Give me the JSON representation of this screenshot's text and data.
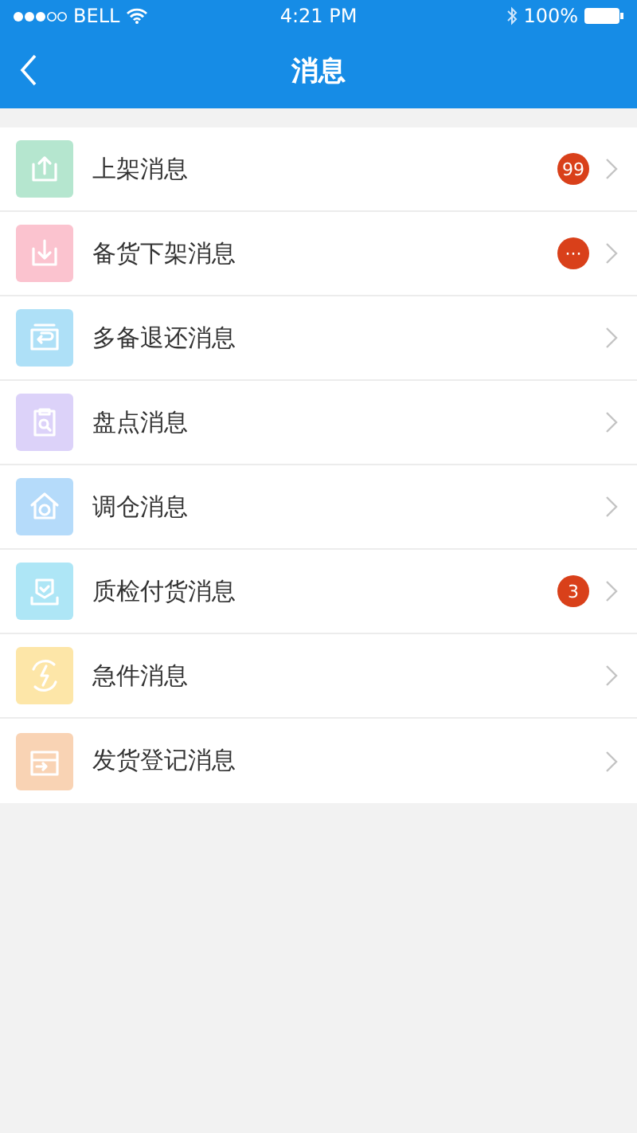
{
  "status_bar": {
    "carrier": "BELL",
    "time": "4:21 PM",
    "battery": "100%"
  },
  "nav": {
    "title": "消息"
  },
  "items": [
    {
      "label": "上架消息",
      "kind": "upload",
      "color": "#b5e6cf",
      "badge": "99"
    },
    {
      "label": "备货下架消息",
      "kind": "download",
      "color": "#fbc3cf",
      "badge": "···"
    },
    {
      "label": "多备退还消息",
      "kind": "return",
      "color": "#aee0f7"
    },
    {
      "label": "盘点消息",
      "kind": "inventory",
      "color": "#dcd2f9"
    },
    {
      "label": "调仓消息",
      "kind": "transfer",
      "color": "#b5dbfa"
    },
    {
      "label": "质检付货消息",
      "kind": "inspect",
      "color": "#aee6f6",
      "badge": "3"
    },
    {
      "label": "急件消息",
      "kind": "urgent",
      "color": "#fde6a8"
    },
    {
      "label": "发货登记消息",
      "kind": "shipping",
      "color": "#f9d3b4"
    }
  ]
}
